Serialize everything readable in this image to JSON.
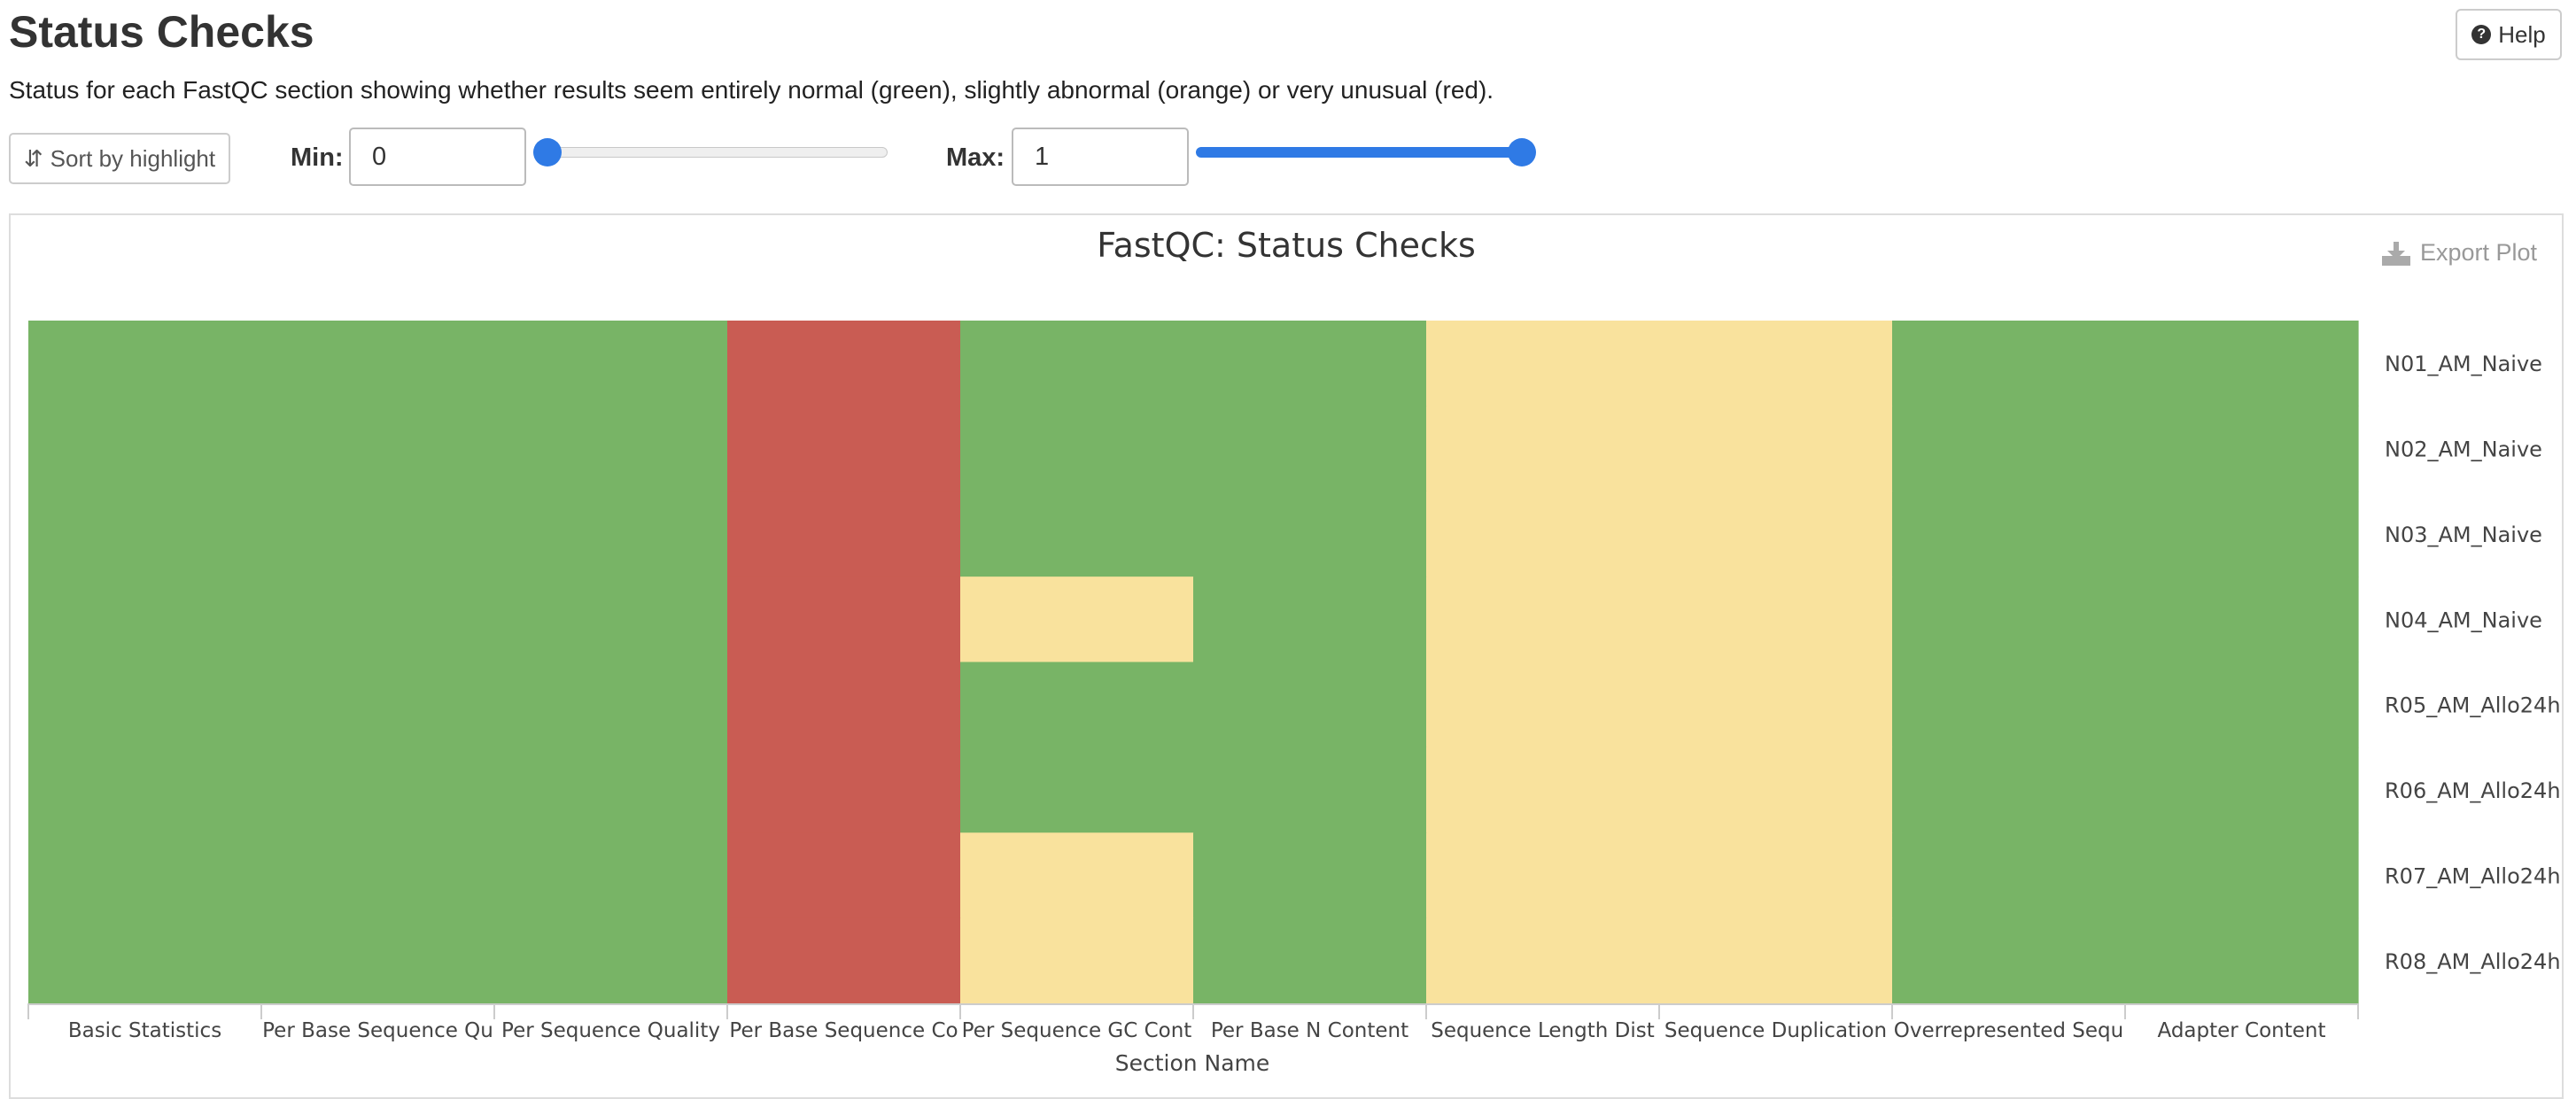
{
  "page": {
    "title": "Status Checks",
    "help_label": "Help",
    "description": "Status for each FastQC section showing whether results seem entirely normal (green), slightly abnormal (orange) or very unusual (red)."
  },
  "controls": {
    "sort_label": "Sort by highlight",
    "min_label": "Min:",
    "min_value": "0",
    "max_label": "Max:",
    "max_value": "1",
    "slider_min_fraction": 0,
    "slider_max_fraction": 1
  },
  "plot": {
    "export_label": "Export Plot"
  },
  "colors": {
    "pass": "#78b466",
    "warn": "#f9e29d",
    "fail": "#c95c53",
    "accent": "#2f7ae5"
  },
  "chart_data": {
    "type": "heatmap",
    "title": "FastQC: Status Checks",
    "xlabel": "Section Name",
    "ylabel": "",
    "x_categories": [
      "Basic Statistics",
      "Per Base Sequence Qu",
      "Per Sequence Quality",
      "Per Base Sequence Co",
      "Per Sequence GC Cont",
      "Per Base N Content",
      "Sequence Length Dist",
      "Sequence Duplication",
      "Overrepresented Sequ",
      "Adapter Content"
    ],
    "y_categories": [
      "N01_AM_Naive",
      "N02_AM_Naive",
      "N03_AM_Naive",
      "N04_AM_Naive",
      "R05_AM_Allo24h",
      "R06_AM_Allo24h",
      "R07_AM_Allo24h",
      "R08_AM_Allo24h"
    ],
    "status": [
      [
        "pass",
        "pass",
        "pass",
        "fail",
        "pass",
        "pass",
        "warn",
        "warn",
        "pass",
        "pass"
      ],
      [
        "pass",
        "pass",
        "pass",
        "fail",
        "pass",
        "pass",
        "warn",
        "warn",
        "pass",
        "pass"
      ],
      [
        "pass",
        "pass",
        "pass",
        "fail",
        "pass",
        "pass",
        "warn",
        "warn",
        "pass",
        "pass"
      ],
      [
        "pass",
        "pass",
        "pass",
        "fail",
        "warn",
        "pass",
        "warn",
        "warn",
        "pass",
        "pass"
      ],
      [
        "pass",
        "pass",
        "pass",
        "fail",
        "pass",
        "pass",
        "warn",
        "warn",
        "pass",
        "pass"
      ],
      [
        "pass",
        "pass",
        "pass",
        "fail",
        "pass",
        "pass",
        "warn",
        "warn",
        "pass",
        "pass"
      ],
      [
        "pass",
        "pass",
        "pass",
        "fail",
        "warn",
        "pass",
        "warn",
        "warn",
        "pass",
        "pass"
      ],
      [
        "pass",
        "pass",
        "pass",
        "fail",
        "warn",
        "pass",
        "warn",
        "warn",
        "pass",
        "pass"
      ]
    ]
  }
}
